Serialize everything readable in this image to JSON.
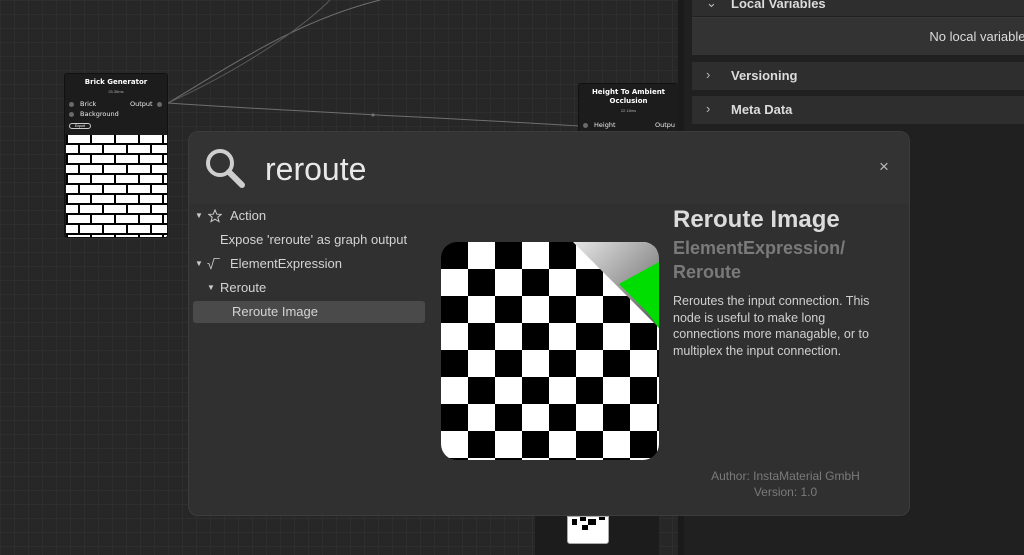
{
  "graph": {
    "brick_node": {
      "title": "Brick Generator",
      "time": "25.36ms",
      "inputs": [
        "Brick",
        "Background"
      ],
      "output": "Output",
      "button": "Export"
    },
    "ao_node": {
      "title": "Height To Ambient Occlusion",
      "time": "22.18ms",
      "input": "Height",
      "output": "Outpu"
    }
  },
  "right_panel": {
    "local_variables": {
      "title": "Local Variables",
      "empty_text": "No local variables"
    },
    "versioning": {
      "title": "Versioning"
    },
    "meta_data": {
      "title": "Meta Data"
    }
  },
  "search": {
    "query": "reroute",
    "close_label": "×",
    "tree": [
      {
        "label": "Action",
        "icon": "star-icon",
        "expanded": true
      },
      {
        "label": "Expose 'reroute' as graph output"
      },
      {
        "label": "ElementExpression",
        "icon": "sqrt-icon",
        "expanded": true
      },
      {
        "label": "Reroute",
        "expanded": true
      },
      {
        "label": "Reroute Image",
        "selected": true
      }
    ],
    "detail": {
      "title": "Reroute Image",
      "path": "ElementExpression/ Reroute",
      "description": "Reroutes the input connection. This node is useful to make long connections more managable, or to multiplex the input connection.",
      "author": "Author: InstaMaterial GmbH",
      "version": "Version: 1.0",
      "icon": "checkerboard-image-icon",
      "accent_color": "#00dd00"
    }
  }
}
